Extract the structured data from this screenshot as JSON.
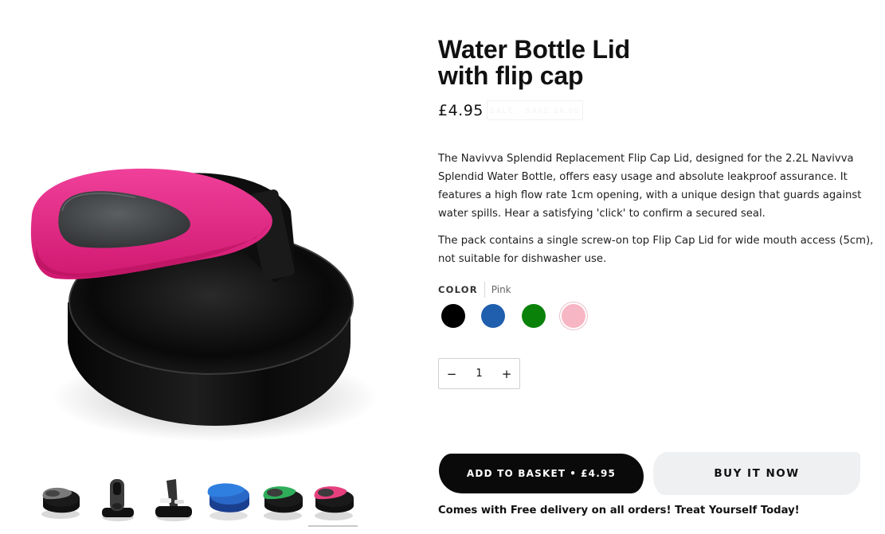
{
  "product": {
    "title_line1": "Water Bottle Lid",
    "title_line2": "with flip cap",
    "price": "£4.95",
    "sale_badge": "SALE · SAVE £0.00",
    "description": [
      "The Navivva Splendid Replacement Flip Cap Lid, designed for the 2.2L Navivva Splendid Water Bottle, offers easy usage and absolute leakproof assurance. It features a high flow rate 1cm opening, with a unique design that guards against water spills. Hear a satisfying 'click' to confirm a secured seal.",
      "The pack contains a single screw-on top Flip Cap Lid for wide mouth access (5cm), not suitable for dishwasher use."
    ]
  },
  "color": {
    "label": "COLOR",
    "selected": "Pink",
    "swatches": [
      {
        "name": "Black",
        "hex": "#000000"
      },
      {
        "name": "Blue",
        "hex": "#1f5fad"
      },
      {
        "name": "Green",
        "hex": "#0a820a"
      },
      {
        "name": "Pink",
        "hex": "#f7b6c3"
      }
    ]
  },
  "quantity": {
    "minus": "−",
    "value": "1",
    "plus": "+"
  },
  "actions": {
    "add_to_basket": "ADD TO BASKET",
    "separator": "•",
    "basket_price": "£4.95",
    "buy_now": "BUY IT NOW"
  },
  "delivery_note": "Comes with Free delivery on all orders! Treat Yourself Today!",
  "gallery": {
    "thumbnails": [
      {
        "name": "grey-lid",
        "accent": "#7a7a7a"
      },
      {
        "name": "lid-side-view",
        "accent": "#444444"
      },
      {
        "name": "lid-open-view",
        "accent": "#555555"
      },
      {
        "name": "blue-lid",
        "accent": "#2a68c8"
      },
      {
        "name": "green-lid",
        "accent": "#2fae5a"
      },
      {
        "name": "pink-lid",
        "accent": "#e6407f"
      }
    ],
    "active_index": 5
  },
  "colors": {
    "lid_accent": "#e5207c",
    "lid_body": "#0b0b0b"
  }
}
